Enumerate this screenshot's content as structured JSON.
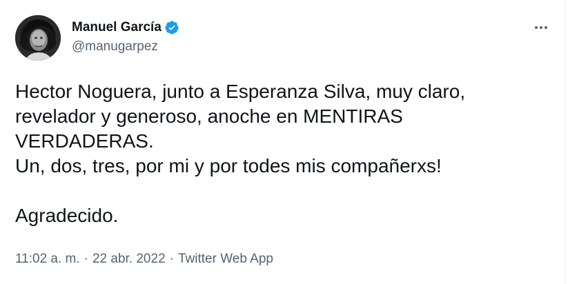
{
  "author": {
    "display_name": "Manuel García",
    "handle": "@manugarpez",
    "verified": true,
    "verified_color": "#1d9bf0",
    "avatar_icon": "profile-photo"
  },
  "menu": {
    "more_icon": "more-horizontal-icon"
  },
  "tweet": {
    "lines": [
      "Hector Noguera, junto a Esperanza Silva, muy claro,",
      "revelador y generoso, anoche en MENTIRAS",
      "VERDADERAS.",
      "Un, dos, tres, por mi y por todes mis compañerxs!",
      "",
      "Agradecido."
    ]
  },
  "meta": {
    "time": "11:02 a. m.",
    "date": "22 abr. 2022",
    "source": "Twitter Web App",
    "separator": "·"
  },
  "colors": {
    "text_primary": "#0f1419",
    "text_secondary": "#536471",
    "accent": "#1d9bf0"
  }
}
